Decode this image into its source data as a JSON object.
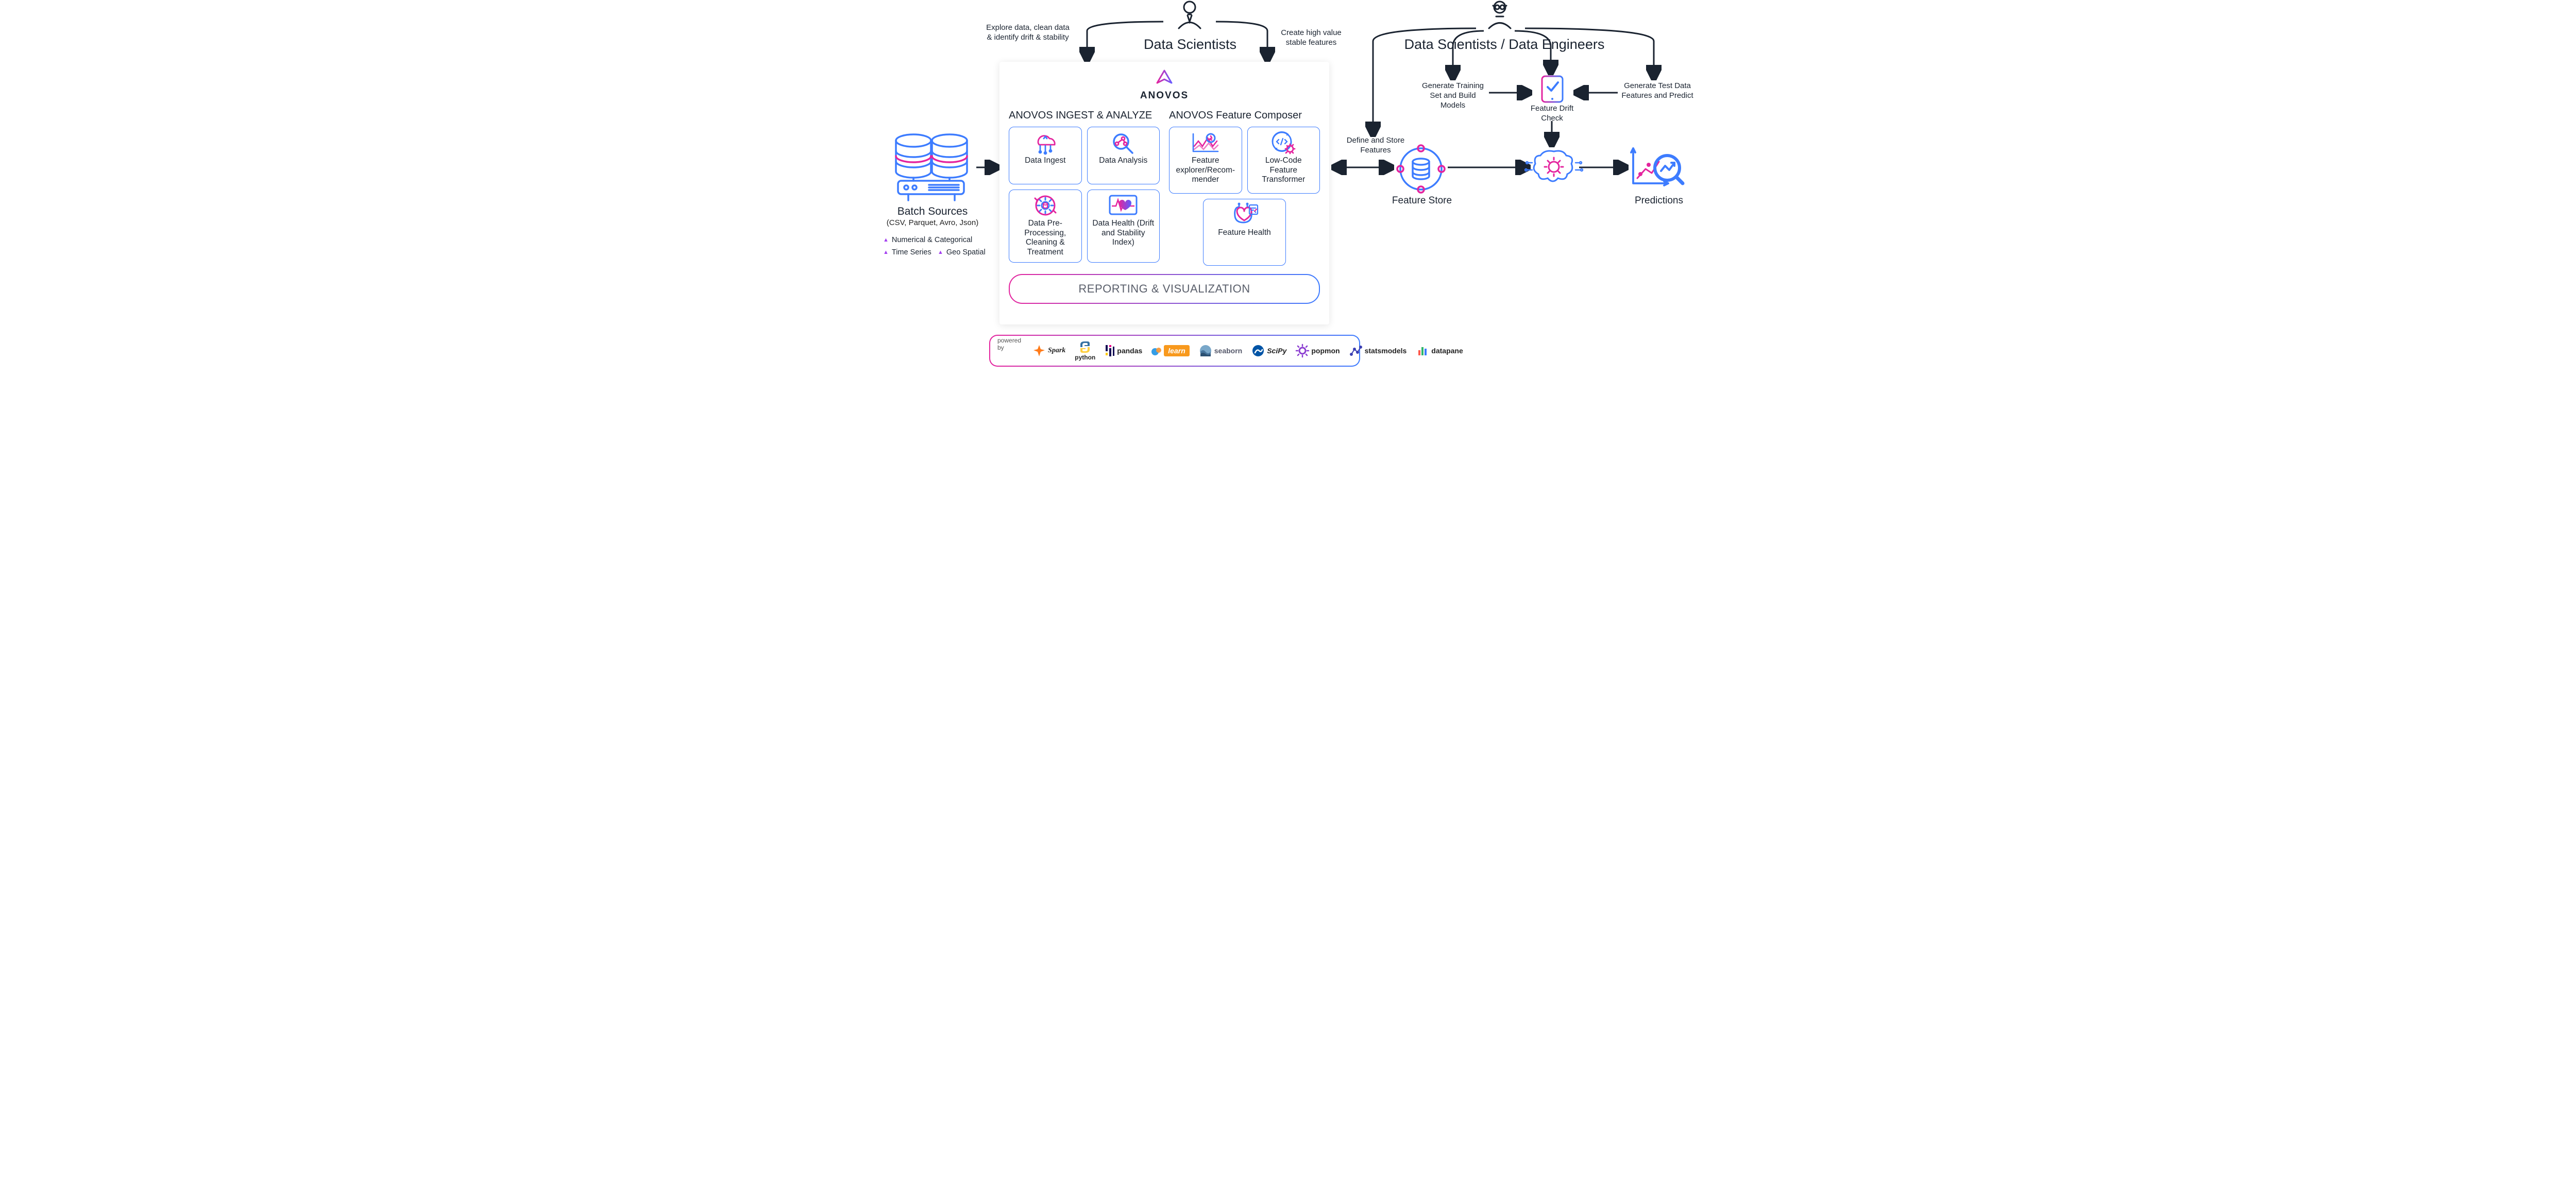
{
  "roles": {
    "data_scientists": "Data Scientists",
    "data_engineers": "Data Scientists / Data Engineers"
  },
  "annotations": {
    "explore": "Explore data, clean data & identify drift & stability",
    "create_features": "Create high value stable features",
    "define_store": "Define and Store Features",
    "generate_training": "Generate Training Set and Build Models",
    "feature_drift": "Feature Drift Check",
    "generate_test": "Generate Test Data Features and Predict"
  },
  "batch": {
    "title": "Batch Sources",
    "subtitle": "(CSV, Parquet, Avro, Json)",
    "types": [
      "Numerical & Categorical",
      "Time Series",
      "Geo Spatial"
    ]
  },
  "anovos": {
    "brand": "ANOVOS",
    "ingest_title": "ANOVOS INGEST & ANALYZE",
    "compose_title": "ANOVOS Feature Composer",
    "ingest_tiles": [
      {
        "label": "Data Ingest"
      },
      {
        "label": "Data Analysis"
      },
      {
        "label": "Data Pre-Processing, Cleaning & Treatment"
      },
      {
        "label": "Data Health (Drift and Stability Index)"
      }
    ],
    "compose_tiles": [
      {
        "label": "Feature explorer/Recom- mender"
      },
      {
        "label": "Low-Code Feature Transformer"
      },
      {
        "label": "Feature Health"
      }
    ],
    "reporting": "REPORTING & VISUALIZATION"
  },
  "pipeline": {
    "feature_store": "Feature Store",
    "predictions": "Predictions"
  },
  "powered": {
    "label": "powered by",
    "tools": [
      "Spark",
      "python",
      "pandas",
      "learn",
      "seaborn",
      "SciPy",
      "popmon",
      "statsmodels",
      "datapane"
    ]
  },
  "colors": {
    "blue": "#3d7cff",
    "magenta": "#e4249e",
    "ink": "#1a2330"
  }
}
